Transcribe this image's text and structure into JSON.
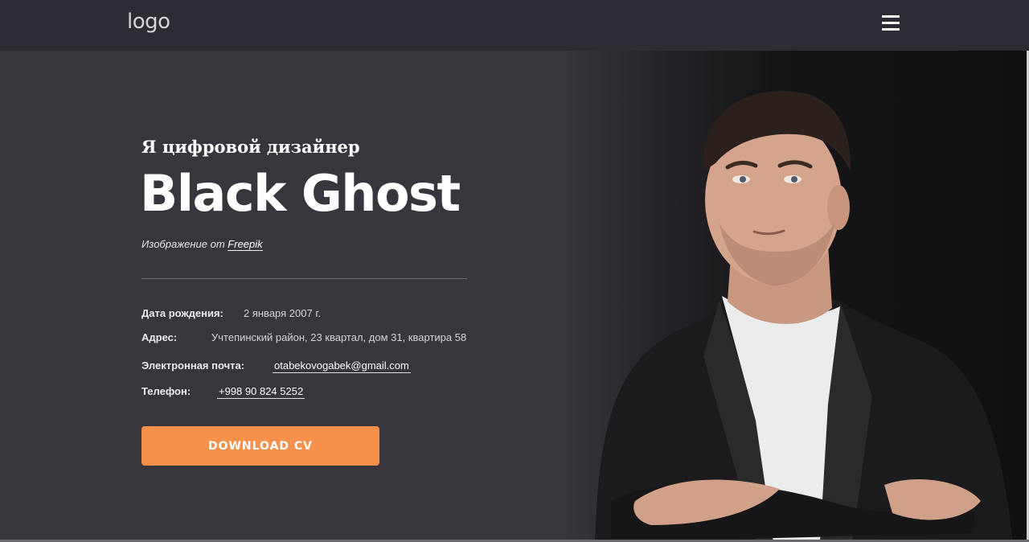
{
  "header": {
    "logo": "logo",
    "menu_icon": "hamburger-menu-icon"
  },
  "hero": {
    "subtitle": "Я цифровой дизайнер",
    "name": "Black Ghost",
    "credit_prefix": "Изображение от",
    "credit_link": "Freepik",
    "birth_label": "Дата рождения:",
    "birth_value": "2 января 2007 г.",
    "address_label": "Адрес:",
    "address_value": "Учтепинский район, 23 квартал, дом 31, квартира 58",
    "email_label": "Электронная почта:",
    "email_value": "otabekovogabek@gmail.com",
    "phone_label": "Телефон:",
    "phone_value": "+998 90 824 5252",
    "button_label": "DOWNLOAD CV"
  },
  "colors": {
    "header_bg": "#2d2b34",
    "page_bg": "#38353d",
    "accent": "#f6904b"
  }
}
